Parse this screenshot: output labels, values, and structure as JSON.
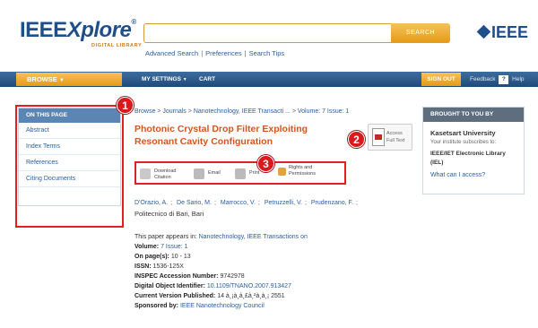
{
  "header": {
    "logo_main": "IEEE",
    "logo_x": "Xplore",
    "logo_reg": "®",
    "logo_sub": "DIGITAL LIBRARY",
    "search_value": "",
    "search_button": "SEARCH",
    "links": [
      "Advanced Search",
      "Preferences",
      "Search Tips"
    ],
    "ieee_brand": "IEEE"
  },
  "nav": {
    "browse": "BROWSE",
    "browse_caret": "▼",
    "my_settings": "MY SETTINGS",
    "my_settings_caret": "▼",
    "cart": "CART",
    "sign_out": "SIGN OUT",
    "feedback": "Feedback",
    "help_icon": "?",
    "help": "Help"
  },
  "left_panel": {
    "head": "ON THIS PAGE",
    "items": [
      "Abstract",
      "Index Terms",
      "References",
      "Citing Documents"
    ]
  },
  "badges": [
    "1",
    "2",
    "3"
  ],
  "article": {
    "breadcrumb": [
      "Browse",
      "Journals",
      "Nanotechnology, IEEE Transacti ...",
      "Volume: 7 Issue: 1"
    ],
    "breadcrumb_seps": [
      ">",
      ">",
      ">"
    ],
    "title_line1": "Photonic Crystal Drop Filter Exploiting",
    "title_line2": "Resonant Cavity Configuration",
    "full_text_line1": "Access",
    "full_text_line2": "Full Text",
    "tools": {
      "download_line1": "Download",
      "download_line2": "Citation",
      "email": "Email",
      "print": "Print",
      "rights_line1": "Rights and",
      "rights_line2": "Permissions"
    },
    "authors": [
      "D'Orazio, A.",
      "De Sario, M.",
      "Marrocco, V.",
      "Petruzzelli, V.",
      "Prudenzano, F."
    ],
    "affiliation": "Politecnico di Bari, Bari",
    "appears_prefix": "This paper appears in:",
    "appears_link": "Nanotechnology, IEEE Transactions on",
    "volume_label": "Volume:",
    "volume_value": "7",
    "issue_link": "Issue: 1",
    "pages_label": "On page(s):",
    "pages_value": "10 - 13",
    "issn_label": "ISSN:",
    "issn_value": "1536-125X",
    "inspec_label": "INSPEC Accession Number:",
    "inspec_value": "9742978",
    "doi_label": "Digital Object Identifier:",
    "doi_value": "10.1109/TNANO.2007.913427",
    "cvp_label": "Current Version Published:",
    "cvp_value": "14 à¸¡à¸à¸£à¸²à¸à¸¡ 2551",
    "sponsor_label": "Sponsored by:",
    "sponsor_value": "IEEE Nanotechnology Council"
  },
  "right_panel": {
    "head": "BROUGHT TO YOU BY",
    "institution": "Kasetsart University",
    "subscribes": "Your institute subscribes to:",
    "library": "IEEE/IET Electronic Library",
    "library_abbr": "(IEL)",
    "access_link": "What can I access?"
  }
}
